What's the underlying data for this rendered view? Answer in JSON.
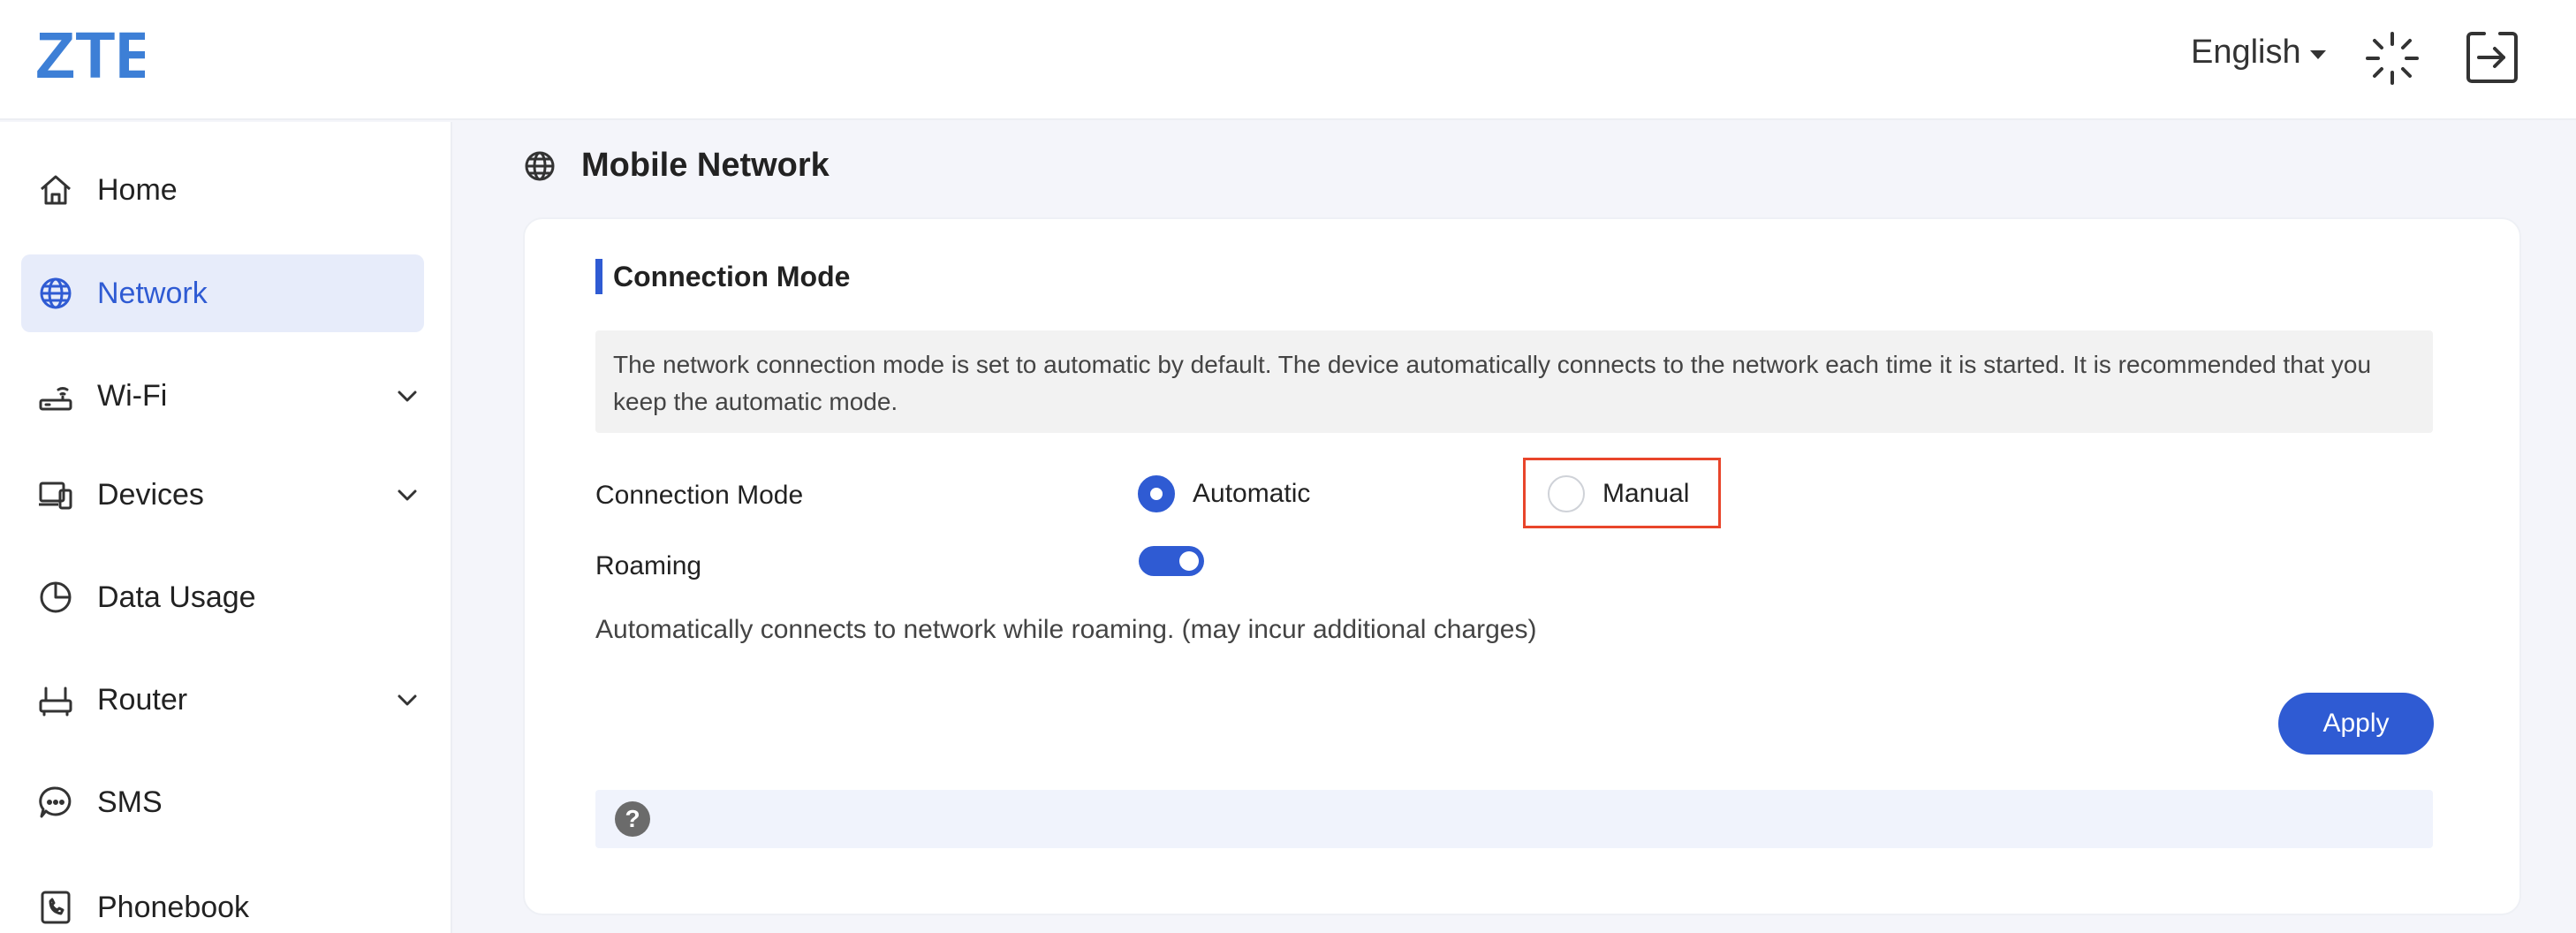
{
  "brand": {
    "logo_text": "ZTE",
    "accent_color": "#2f5bd3",
    "logo_color": "#3d7fd6"
  },
  "header": {
    "language": "English",
    "icons": [
      "loading-spinner-icon",
      "logout-icon"
    ]
  },
  "sidebar": {
    "items": [
      {
        "label": "Home",
        "icon": "home-icon",
        "active": false,
        "expandable": false
      },
      {
        "label": "Network",
        "icon": "globe-icon",
        "active": true,
        "expandable": false
      },
      {
        "label": "Wi-Fi",
        "icon": "router-wifi-icon",
        "active": false,
        "expandable": true
      },
      {
        "label": "Devices",
        "icon": "devices-icon",
        "active": false,
        "expandable": true
      },
      {
        "label": "Data Usage",
        "icon": "pie-chart-icon",
        "active": false,
        "expandable": false
      },
      {
        "label": "Router",
        "icon": "router-icon",
        "active": false,
        "expandable": true
      },
      {
        "label": "SMS",
        "icon": "chat-bubble-icon",
        "active": false,
        "expandable": false
      },
      {
        "label": "Phonebook",
        "icon": "phonebook-icon",
        "active": false,
        "expandable": false
      }
    ]
  },
  "main": {
    "page_title": "Mobile Network",
    "section_title": "Connection Mode",
    "info_text": "The network connection mode is set to automatic by default. The device automatically connects to the network each time it is started. It is recommended that you keep the automatic mode.",
    "connection_mode": {
      "label": "Connection Mode",
      "options": [
        {
          "label": "Automatic",
          "checked": true
        },
        {
          "label": "Manual",
          "checked": false
        }
      ]
    },
    "roaming": {
      "label": "Roaming",
      "enabled": true
    },
    "roaming_description": "Automatically connects to network while roaming. (may incur additional charges)",
    "apply_label": "Apply",
    "help_icon_text": "?"
  }
}
